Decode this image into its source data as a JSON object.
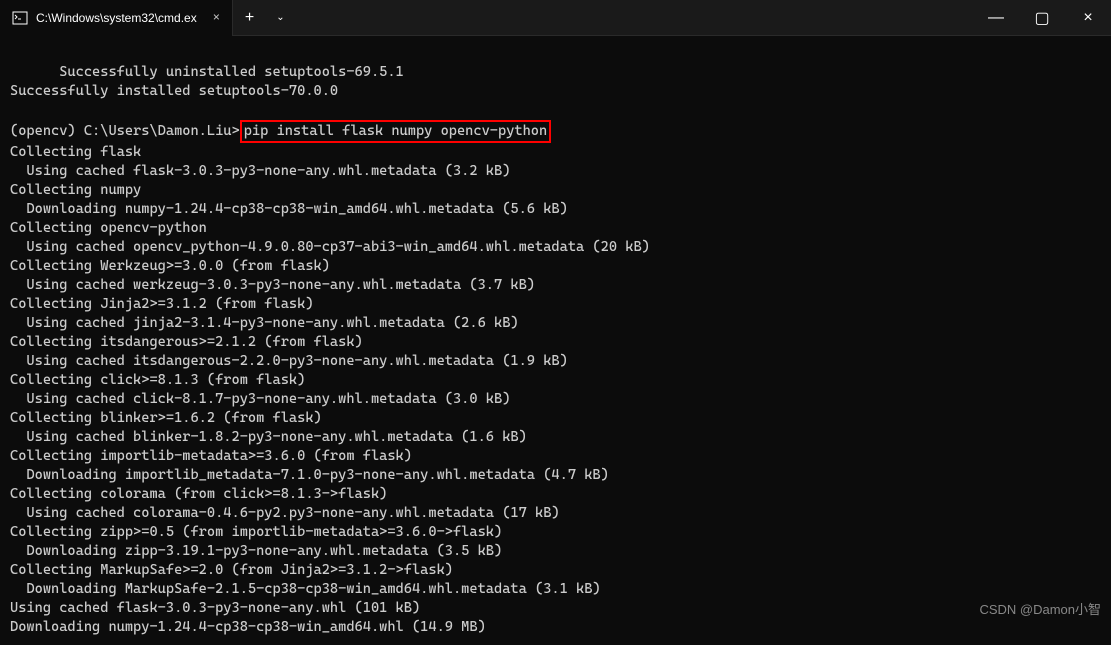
{
  "titlebar": {
    "tab_title": "C:\\Windows\\system32\\cmd.ex",
    "close_glyph": "×",
    "newtab_glyph": "+",
    "dropdown_glyph": "⌄"
  },
  "window_controls": {
    "minimize": "—",
    "maximize": "▢",
    "close": "×"
  },
  "terminal_lines": [
    "      Successfully uninstalled setuptools-69.5.1",
    "Successfully installed setuptools-70.0.0",
    "",
    "",
    "Collecting flask",
    "  Using cached flask-3.0.3-py3-none-any.whl.metadata (3.2 kB)",
    "Collecting numpy",
    "  Downloading numpy-1.24.4-cp38-cp38-win_amd64.whl.metadata (5.6 kB)",
    "Collecting opencv-python",
    "  Using cached opencv_python-4.9.0.80-cp37-abi3-win_amd64.whl.metadata (20 kB)",
    "Collecting Werkzeug>=3.0.0 (from flask)",
    "  Using cached werkzeug-3.0.3-py3-none-any.whl.metadata (3.7 kB)",
    "Collecting Jinja2>=3.1.2 (from flask)",
    "  Using cached jinja2-3.1.4-py3-none-any.whl.metadata (2.6 kB)",
    "Collecting itsdangerous>=2.1.2 (from flask)",
    "  Using cached itsdangerous-2.2.0-py3-none-any.whl.metadata (1.9 kB)",
    "Collecting click>=8.1.3 (from flask)",
    "  Using cached click-8.1.7-py3-none-any.whl.metadata (3.0 kB)",
    "Collecting blinker>=1.6.2 (from flask)",
    "  Using cached blinker-1.8.2-py3-none-any.whl.metadata (1.6 kB)",
    "Collecting importlib-metadata>=3.6.0 (from flask)",
    "  Downloading importlib_metadata-7.1.0-py3-none-any.whl.metadata (4.7 kB)",
    "Collecting colorama (from click>=8.1.3->flask)",
    "  Using cached colorama-0.4.6-py2.py3-none-any.whl.metadata (17 kB)",
    "Collecting zipp>=0.5 (from importlib-metadata>=3.6.0->flask)",
    "  Downloading zipp-3.19.1-py3-none-any.whl.metadata (3.5 kB)",
    "Collecting MarkupSafe>=2.0 (from Jinja2>=3.1.2->flask)",
    "  Downloading MarkupSafe-2.1.5-cp38-cp38-win_amd64.whl.metadata (3.1 kB)",
    "Using cached flask-3.0.3-py3-none-any.whl (101 kB)",
    "Downloading numpy-1.24.4-cp38-cp38-win_amd64.whl (14.9 MB)"
  ],
  "prompt_line": {
    "before": "(opencv) C:\\Users\\Damon.Liu>",
    "highlighted": "pip install flask numpy opencv-python"
  },
  "watermark": "CSDN @Damon小智"
}
